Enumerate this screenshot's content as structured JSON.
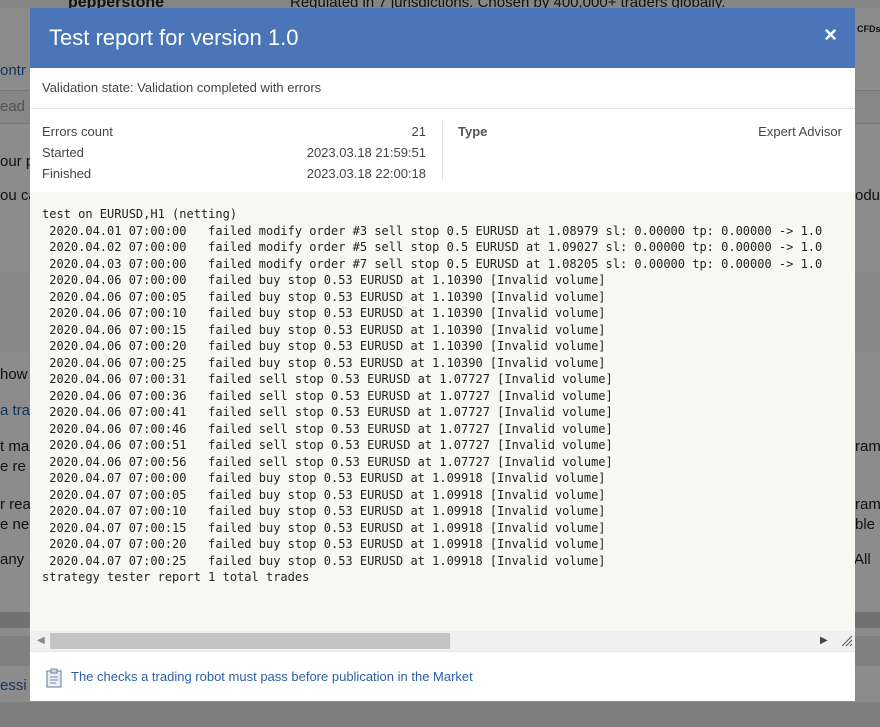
{
  "background": {
    "brand": "pepperstone",
    "tagline": "Regulated in 7 jurisdictions. Chosen by 400,000+ traders globally.",
    "corner_tag": "CFDs w",
    "fragments": [
      "ontr",
      "ead",
      "our p",
      "ou ca",
      "odu",
      "how",
      "a tra",
      "t ma",
      "e re",
      "ram",
      "r rea",
      "ram",
      "e ne",
      "ble",
      "any",
      "All",
      "essi"
    ]
  },
  "dialog": {
    "title": "Test report for version 1.0",
    "close_label": "×",
    "validation_state": "Validation state: Validation completed with errors",
    "summary": {
      "errors_label": "Errors count",
      "errors_value": "21",
      "started_label": "Started",
      "started_value": "2023.03.18 21:59:51",
      "finished_label": "Finished",
      "finished_value": "2023.03.18 22:00:18",
      "type_label": "Type",
      "type_value": "Expert Advisor"
    },
    "log_lines": [
      "test on EURUSD,H1 (netting)",
      " 2020.04.01 07:00:00   failed modify order #3 sell stop 0.5 EURUSD at 1.08979 sl: 0.00000 tp: 0.00000 -> 1.0",
      " 2020.04.02 07:00:00   failed modify order #5 sell stop 0.5 EURUSD at 1.09027 sl: 0.00000 tp: 0.00000 -> 1.0",
      " 2020.04.03 07:00:00   failed modify order #7 sell stop 0.5 EURUSD at 1.08205 sl: 0.00000 tp: 0.00000 -> 1.0",
      " 2020.04.06 07:00:00   failed buy stop 0.53 EURUSD at 1.10390 [Invalid volume]",
      " 2020.04.06 07:00:05   failed buy stop 0.53 EURUSD at 1.10390 [Invalid volume]",
      " 2020.04.06 07:00:10   failed buy stop 0.53 EURUSD at 1.10390 [Invalid volume]",
      " 2020.04.06 07:00:15   failed buy stop 0.53 EURUSD at 1.10390 [Invalid volume]",
      " 2020.04.06 07:00:20   failed buy stop 0.53 EURUSD at 1.10390 [Invalid volume]",
      " 2020.04.06 07:00:25   failed buy stop 0.53 EURUSD at 1.10390 [Invalid volume]",
      " 2020.04.06 07:00:31   failed sell stop 0.53 EURUSD at 1.07727 [Invalid volume]",
      " 2020.04.06 07:00:36   failed sell stop 0.53 EURUSD at 1.07727 [Invalid volume]",
      " 2020.04.06 07:00:41   failed sell stop 0.53 EURUSD at 1.07727 [Invalid volume]",
      " 2020.04.06 07:00:46   failed sell stop 0.53 EURUSD at 1.07727 [Invalid volume]",
      " 2020.04.06 07:00:51   failed sell stop 0.53 EURUSD at 1.07727 [Invalid volume]",
      " 2020.04.06 07:00:56   failed sell stop 0.53 EURUSD at 1.07727 [Invalid volume]",
      " 2020.04.07 07:00:00   failed buy stop 0.53 EURUSD at 1.09918 [Invalid volume]",
      " 2020.04.07 07:00:05   failed buy stop 0.53 EURUSD at 1.09918 [Invalid volume]",
      " 2020.04.07 07:00:10   failed buy stop 0.53 EURUSD at 1.09918 [Invalid volume]",
      " 2020.04.07 07:00:15   failed buy stop 0.53 EURUSD at 1.09918 [Invalid volume]",
      " 2020.04.07 07:00:20   failed buy stop 0.53 EURUSD at 1.09918 [Invalid volume]",
      " 2020.04.07 07:00:25   failed buy stop 0.53 EURUSD at 1.09918 [Invalid volume]",
      "strategy tester report 1 total trades"
    ],
    "footer_link": "The checks a trading robot must pass before publication in the Market"
  },
  "colors": {
    "header": "#4a76b9",
    "link": "#2a5fa8",
    "log_bg": "#f7f7f4"
  },
  "icons": {
    "close": "close-icon",
    "footer": "clipboard-icon"
  }
}
